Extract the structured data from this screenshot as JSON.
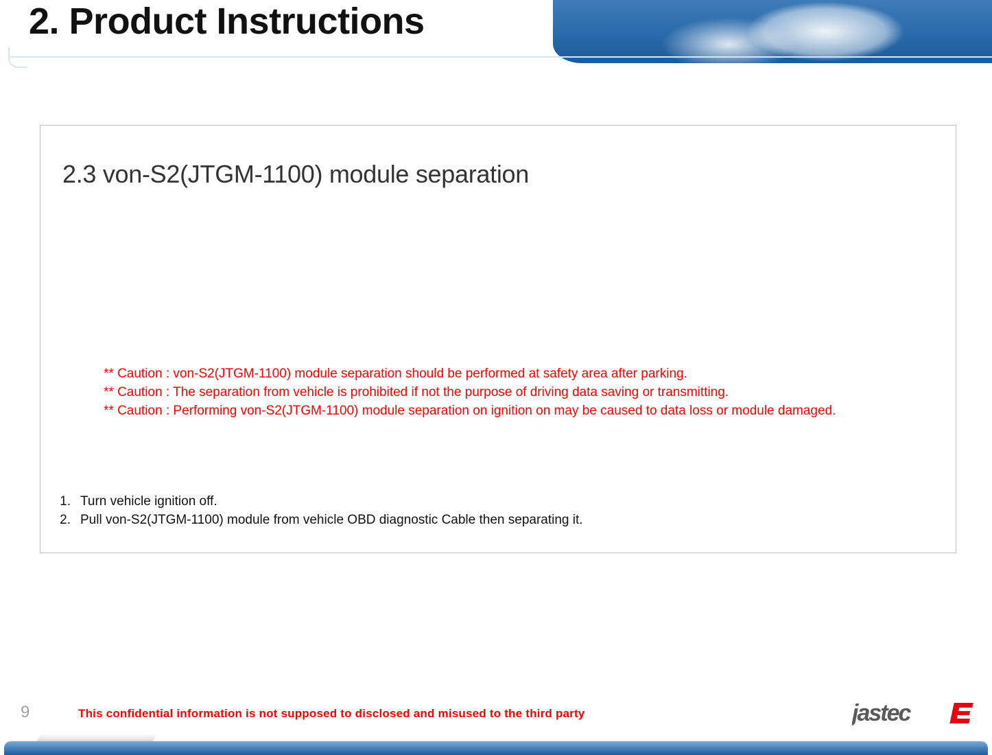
{
  "header": {
    "title": "2. Product Instructions"
  },
  "section": {
    "heading": "2.3 von-S2(JTGM-1100) module separation",
    "cautions": [
      "** Caution : von-S2(JTGM-1100) module separation should be performed at safety area after parking.",
      "** Caution : The separation from vehicle is prohibited if not the purpose of driving data saving or transmitting.",
      "** Caution : Performing von-S2(JTGM-1100) module separation on ignition on may be caused to data loss or module damaged."
    ],
    "steps": [
      {
        "n": "1.",
        "text": "Turn vehicle ignition off."
      },
      {
        "n": "2.",
        "text": "Pull von-S2(JTGM-1100) module from vehicle OBD diagnostic Cable then separating it."
      }
    ]
  },
  "footer": {
    "page_number": "9",
    "note": "This confidential information is not supposed to disclosed and misused to the third party",
    "logo_text": "jastec"
  }
}
